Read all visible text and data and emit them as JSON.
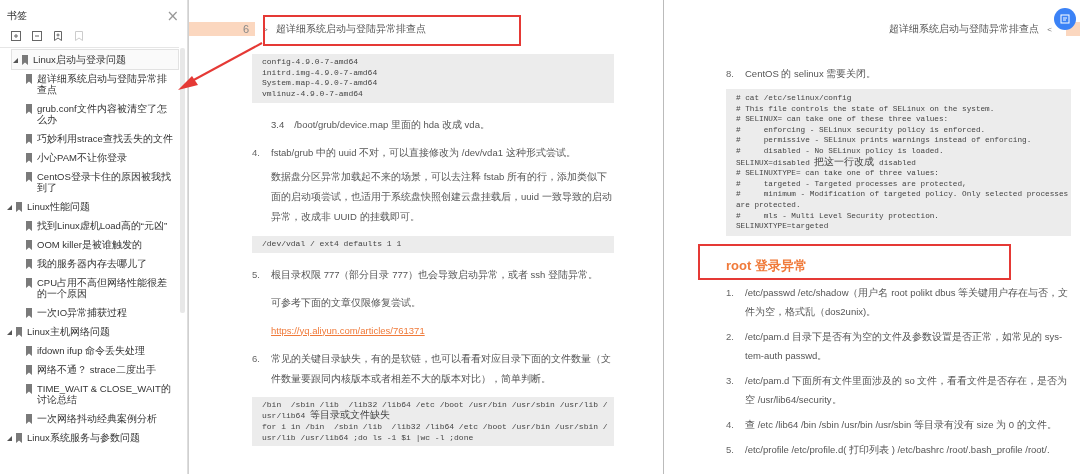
{
  "sidebar": {
    "title": "书签",
    "close": "×",
    "bookmarks": [
      {
        "label": "Linux启动与登录问题",
        "expanded": true,
        "selected": true,
        "children": [
          {
            "label": "超详细系统启动与登陆异常排查点",
            "selected": false
          },
          {
            "label": "grub.conf文件内容被清空了怎么办",
            "selected": false
          },
          {
            "label": "巧妙利用strace查找丢失的文件",
            "selected": false
          },
          {
            "label": "小心PAM不让你登录",
            "selected": false
          },
          {
            "label": "CentOS登录卡住的原因被我找到了",
            "selected": false
          }
        ]
      },
      {
        "label": "Linux性能问题",
        "expanded": true,
        "selected": false,
        "children": [
          {
            "label": "找到Linux虚机Load高的“元凶”",
            "selected": false
          },
          {
            "label": "OOM killer是被谁触发的",
            "selected": false
          },
          {
            "label": "我的服务器内存去哪儿了",
            "selected": false
          },
          {
            "label": "CPU占用不高但网络性能很差的一个原因",
            "selected": false
          },
          {
            "label": "一次IO异常捕获过程",
            "selected": false
          }
        ]
      },
      {
        "label": "Linux主机网络问题",
        "expanded": true,
        "selected": false,
        "children": [
          {
            "label": "ifdown ifup 命令丢失处理",
            "selected": false
          },
          {
            "label": "网络不通？ strace二度出手",
            "selected": false
          },
          {
            "label": "TIME_WAIT & CLOSE_WAIT的讨论总结",
            "selected": false
          },
          {
            "label": "一次网络抖动经典案例分析",
            "selected": false
          }
        ]
      },
      {
        "label": "Linux系统服务与参数问题",
        "expanded": true,
        "selected": false
      }
    ]
  },
  "left_page": {
    "page_number": "6",
    "header_arrow": ">",
    "header_title": "超详细系统启动与登陆异常排查点",
    "blocks": [
      {
        "kind": "code",
        "lines": [
          "config-4.9.0-7-amd64",
          "initrd.img-4.9.0-7-amd64",
          "System.map-4.9.0-7-amd64",
          "vmlinuz-4.9.0-7-amd64"
        ]
      },
      {
        "kind": "sub",
        "text": "3.4　/boot/grub/device.map 里面的 hda 改成 vda。"
      },
      {
        "kind": "numbered",
        "number": "4.",
        "text": "fstab/grub 中的 uuid 不对，可以直接修改为 /dev/vda1 这种形式尝试。"
      },
      {
        "kind": "sub",
        "text": "数据盘分区异常加载起不来的场景，可以去注释 fstab 所有的行，添加类似下面的启动项尝试，也适用于系统盘快照创建云盘挂载后，uuid 一致导致的启动异常，改成非 UUID 的挂载即可。"
      },
      {
        "kind": "code",
        "lines": [
          "/dev/vdal / ext4 defaults 1 1"
        ]
      },
      {
        "kind": "numbered",
        "number": "5.",
        "text": "根目录权限 777（部分目录 777）也会导致启动异常，或者 ssh 登陆异常。"
      },
      {
        "kind": "sub",
        "text": "可参考下面的文章仅限修复尝试。"
      },
      {
        "kind": "link",
        "text": "https://yq.aliyun.com/articles/761371"
      },
      {
        "kind": "numbered",
        "number": "6.",
        "text": "常见的关键目录缺失，有的是软链，也可以看看对应目录下面的文件数量（文件数量要跟同内核版本或者相差不大的版本对比），简单判断。"
      },
      {
        "kind": "code",
        "lines": [
          "/bin  /sbin /lib  /lib32 /lib64 /etc /boot /usr/bin /usr/sbin /usr/lib /",
          "usr/lib64 等目录或文件缺失",
          "for i in /bin  /sbin /lib  /lib32 /lib64 /etc /boot /usr/bin /usr/sbin /",
          "usr/lib /usr/lib64 ;do ls -1 $i |wc -l ;done"
        ]
      }
    ]
  },
  "right_page": {
    "header_title": "超详细系统启动与登陆异常排查点",
    "header_arrow": "<",
    "blocks": [
      {
        "kind": "numbered",
        "number": "8.",
        "text": "CentOS 的 selinux 需要关闭。"
      },
      {
        "kind": "code",
        "lines": [
          "# cat /etc/selinux/config",
          "# This file controls the state of SELinux on the system.",
          "# SELINUX= can take one of these three values:",
          "#     enforcing - SELinux security policy is enforced.",
          "#     permissive - SELinux prints warnings instead of enforcing.",
          "#     disabled - No SELinux policy is loaded.",
          "SELINUX=disabled 把这一行改成 disabled",
          "# SELINUXTYPE= can take one of three values:",
          "#     targeted - Targeted processes are protected,",
          "#     minimum - Modification of targeted policy. Only selected processes",
          "are protected.",
          "#     mls - Multi Level Security protection.",
          "SELINUXTYPE=targeted"
        ]
      },
      {
        "kind": "heading",
        "text": "root 登录异常"
      },
      {
        "kind": "numbered",
        "number": "1.",
        "text": "/etc/passwd /etc/shadow（用户名 root polikt dbus 等关键用户存在与否，文件为空，格式乱（dos2unix)。"
      },
      {
        "kind": "numbered",
        "number": "2.",
        "text": "/etc/pam.d 目录下是否有为空的文件及参数设置是否正常，如常见的 sys-tem-auth passwd。"
      },
      {
        "kind": "numbered",
        "number": "3.",
        "text": "/etc/pam.d 下面所有文件里面涉及的 so 文件，看看文件是否存在，是否为空 /usr/lib64/security。"
      },
      {
        "kind": "numbered",
        "number": "4.",
        "text": "查 /etc /lib64 /bin /sbin /usr/bin /usr/sbin 等目录有没有 size 为 0 的文件。"
      },
      {
        "kind": "numbered",
        "number": "5.",
        "text": "/etc/profile /etc/profile.d( 打印列表 ) /etc/bashrc /root/.bash_profile /root/."
      }
    ]
  }
}
